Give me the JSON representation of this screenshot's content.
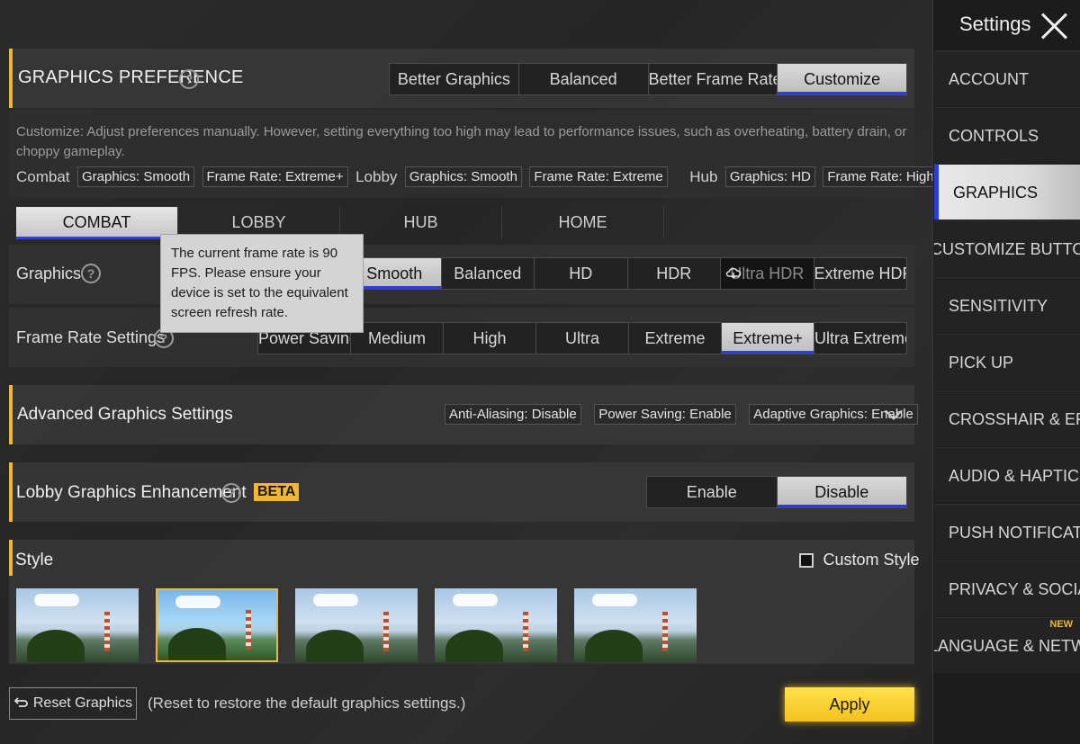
{
  "preference": {
    "title": "GRAPHICS PREFERENCE",
    "help": "?",
    "options": [
      "Better Graphics",
      "Balanced",
      "Better Frame Rate",
      "Customize"
    ],
    "selected": "Customize",
    "description": "Customize: Adjust preferences manually. However, setting everything too high may lead to performance issues, such as overheating, battery drain, or choppy gameplay.",
    "summary": {
      "combat_label": "Combat",
      "combat_graphics": "Graphics: Smooth",
      "combat_framerate": "Frame Rate: Extreme+",
      "lobby_label": "Lobby",
      "lobby_graphics": "Graphics: Smooth",
      "lobby_framerate": "Frame Rate: Extreme",
      "hub_label": "Hub",
      "hub_graphics": "Graphics: HD",
      "hub_framerate": "Frame Rate: High"
    }
  },
  "tabs": [
    "COMBAT",
    "LOBBY",
    "HUB",
    "HOME"
  ],
  "selected_tab": "COMBAT",
  "graphics": {
    "label": "Graphics",
    "options": [
      "Smooth",
      "Balanced",
      "HD",
      "HDR",
      "Ultra HDR",
      "Extreme HDR"
    ],
    "selected": "Smooth"
  },
  "framerate": {
    "label": "Frame Rate Settings",
    "options": [
      "Power Saving",
      "Medium",
      "High",
      "Ultra",
      "Extreme",
      "Extreme+",
      "Ultra Extreme"
    ],
    "selected": "Extreme+"
  },
  "tooltip": "The current frame rate is 90 FPS. Please ensure your device is set to the equivalent screen refresh rate.",
  "advanced": {
    "title": "Advanced Graphics Settings",
    "tags": [
      "Anti-Aliasing: Disable",
      "Power Saving: Enable",
      "Adaptive Graphics: Enable"
    ]
  },
  "lobby_enhancement": {
    "title": "Lobby Graphics Enhancement",
    "badge": "BETA",
    "options": [
      "Enable",
      "Disable"
    ],
    "selected": "Disable"
  },
  "style": {
    "title": "Style",
    "custom_label": "Custom Style",
    "selected_index": 1
  },
  "footer": {
    "reset": "Reset Graphics",
    "reset_hint": "(Reset to restore the default graphics settings.)",
    "apply": "Apply"
  },
  "sidebar": {
    "title": "Settings",
    "items": [
      {
        "label": "ACCOUNT"
      },
      {
        "label": "CONTROLS"
      },
      {
        "label": "GRAPHICS"
      },
      {
        "label": "CUSTOMIZE BUTTONS"
      },
      {
        "label": "SENSITIVITY"
      },
      {
        "label": "PICK UP"
      },
      {
        "label": "CROSSHAIR & EFFECTS"
      },
      {
        "label": "AUDIO & HAPTICS"
      },
      {
        "label": "PUSH NOTIFICATIONS"
      },
      {
        "label": "PRIVACY & SOCIAL"
      },
      {
        "label": "LANGUAGE & NETWORK",
        "badge": "NEW"
      }
    ],
    "selected": "GRAPHICS"
  },
  "colors": {
    "accent": "#f2b632",
    "selection_underline": "#2c3de0",
    "apply": "#f6c928"
  }
}
